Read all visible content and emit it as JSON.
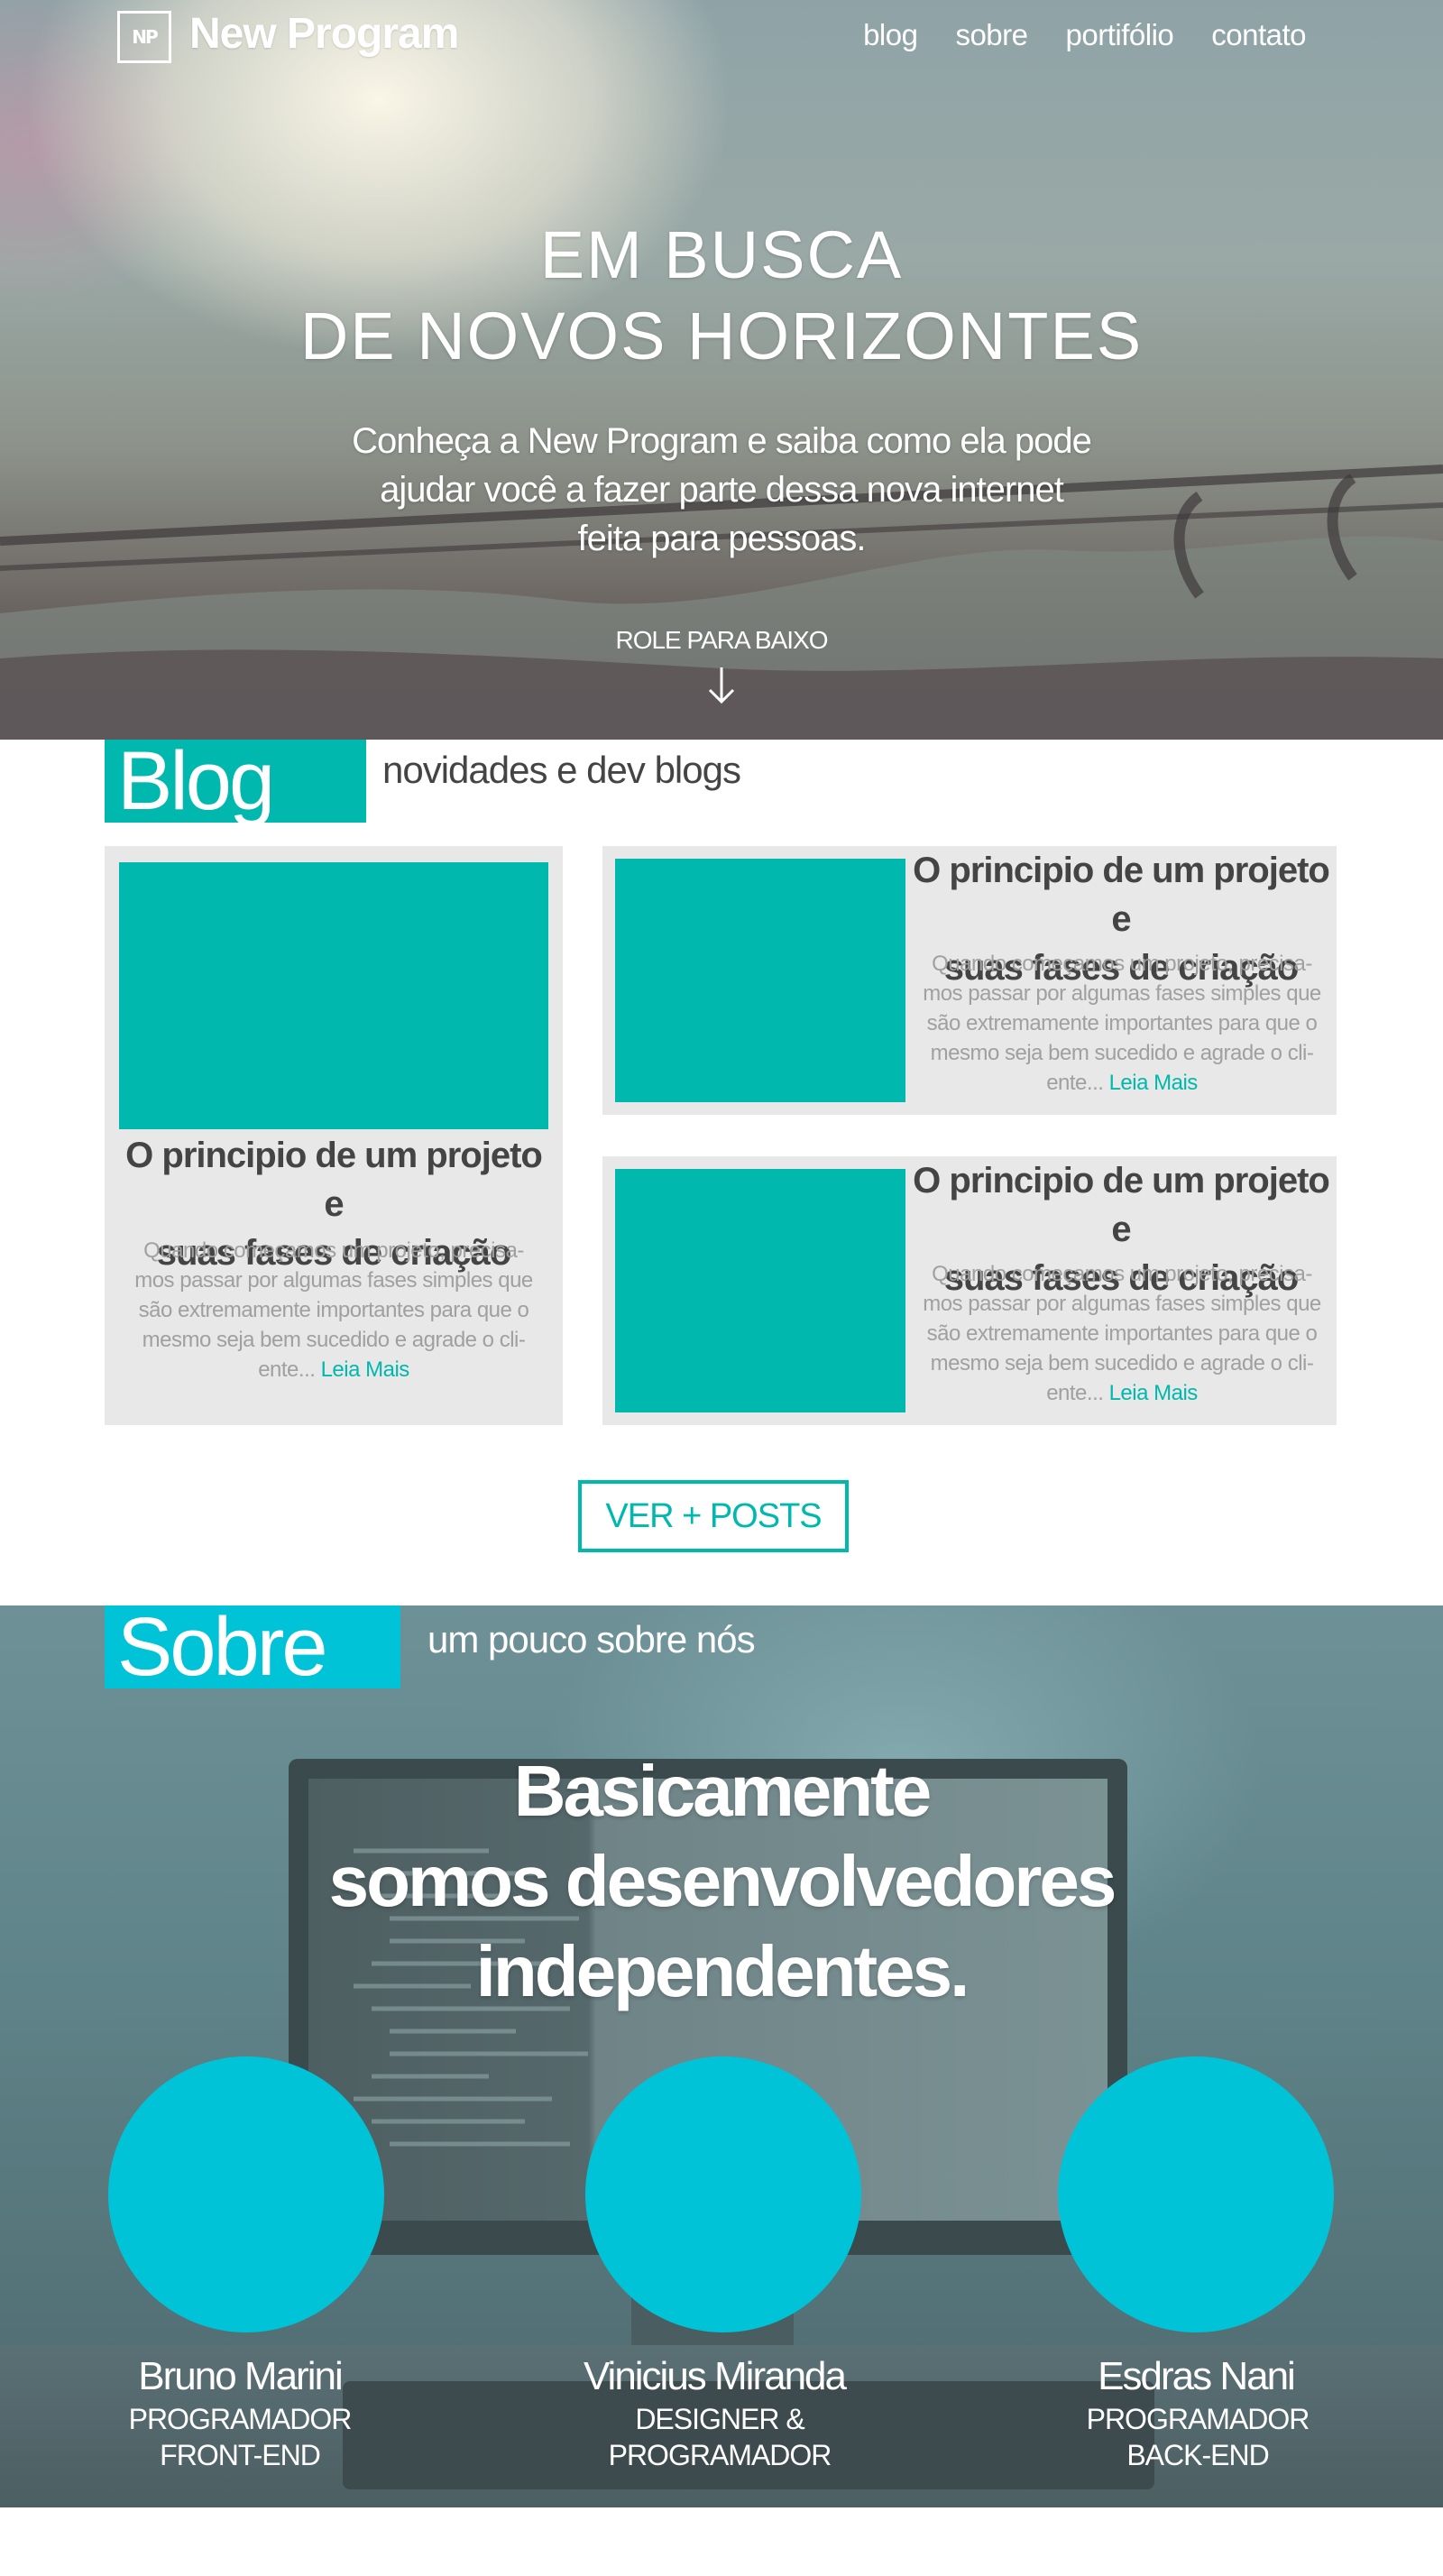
{
  "header": {
    "logo_mark": "NP",
    "logo_text": "New Program",
    "menu": [
      "blog",
      "sobre",
      "portifólio",
      "contato"
    ]
  },
  "hero": {
    "title_line1": "EM BUSCA",
    "title_line2": "DE NOVOS HORIZONTES",
    "subtitle_line1": "Conheça a New Program e saiba como ela pode",
    "subtitle_line2": "ajudar você a fazer parte dessa nova internet",
    "subtitle_line3": "feita para pessoas.",
    "scroll_label": "ROLE PARA BAIXO"
  },
  "blog": {
    "label": "Blog",
    "tagline": "novidades e dev blogs",
    "posts": [
      {
        "title_line1": "O principio de um projeto e",
        "title_line2": "suas fases de criação",
        "excerpt_line1": "Quando começamos um projeto, precisa-",
        "excerpt_line2": "mos passar por algumas fases simples que",
        "excerpt_line3": "são extremamente importantes para que o",
        "excerpt_line4": "mesmo seja bem sucedido e agrade o cli-",
        "excerpt_line5": "ente...",
        "more": "Leia Mais"
      },
      {
        "title_line1": "O principio de um projeto e",
        "title_line2": "suas fases de criação",
        "excerpt_line1": "Quando começamos um projeto, precisa-",
        "excerpt_line2": "mos passar por algumas fases simples que",
        "excerpt_line3": "são extremamente importantes para que o",
        "excerpt_line4": "mesmo seja bem sucedido e agrade o cli-",
        "excerpt_line5": "ente...",
        "more": "Leia Mais"
      },
      {
        "title_line1": "O principio de um projeto e",
        "title_line2": "suas fases de criação",
        "excerpt_line1": "Quando começamos um projeto, precisa-",
        "excerpt_line2": "mos passar por algumas fases simples que",
        "excerpt_line3": "são extremamente importantes para que o",
        "excerpt_line4": "mesmo seja bem sucedido e agrade o cli-",
        "excerpt_line5": "ente...",
        "more": "Leia Mais"
      }
    ],
    "button": "VER + POSTS"
  },
  "sobre": {
    "label": "Sobre",
    "tagline": "um pouco sobre nós",
    "heading_line1": "Basicamente",
    "heading_line2": "somos desenvolvedores",
    "heading_line3": "independentes.",
    "team": [
      {
        "name": "Bruno Marini",
        "role_line1": "PROGRAMADOR",
        "role_line2": "FRONT-END"
      },
      {
        "name": "Vinicius Miranda",
        "role_line1": "DESIGNER &",
        "role_line2": "PROGRAMADOR"
      },
      {
        "name": "Esdras Nani",
        "role_line1": "PROGRAMADOR",
        "role_line2": "BACK-END"
      }
    ]
  },
  "colors": {
    "teal": "#00b8ad",
    "cyan": "#00c3d8",
    "card_bg": "#e8e8e8"
  }
}
